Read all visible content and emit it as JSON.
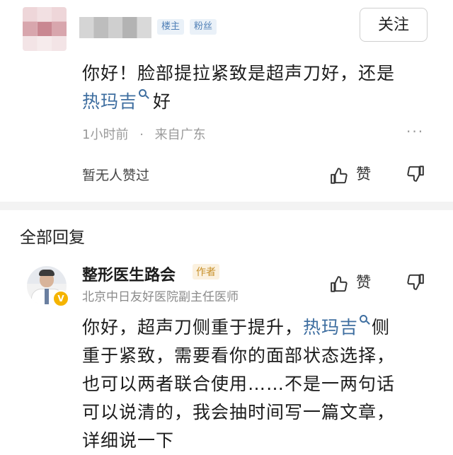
{
  "question": {
    "badges": [
      "楼主",
      "粉丝"
    ],
    "follow_label": "关注",
    "text_line1": "你好！脸部提拉紧致是超声刀好，还是",
    "link": "热玛吉",
    "text_line2_tail": "好",
    "time": "1小时前",
    "sep": "·",
    "location": "来自广东",
    "more": "···",
    "no_likes": "暂无人赞过",
    "like_label": "赞"
  },
  "replies_section": {
    "title": "全部回复"
  },
  "reply": {
    "name": "整形医生路会",
    "author_badge": "作者",
    "verified_mark": "V",
    "title": "北京中日友好医院副主任医师",
    "like_label": "赞",
    "line1_pre": "你好，超声刀侧重于提升，",
    "link": "热玛吉",
    "line1_post": "侧",
    "line2": "重于紧致，需要看你的面部状态选择，",
    "line3": "也可以两者联合使用……不是一两句话",
    "line4": "可以说清的，我会抽时间写一篇文章，",
    "line5": "详细说一下"
  }
}
